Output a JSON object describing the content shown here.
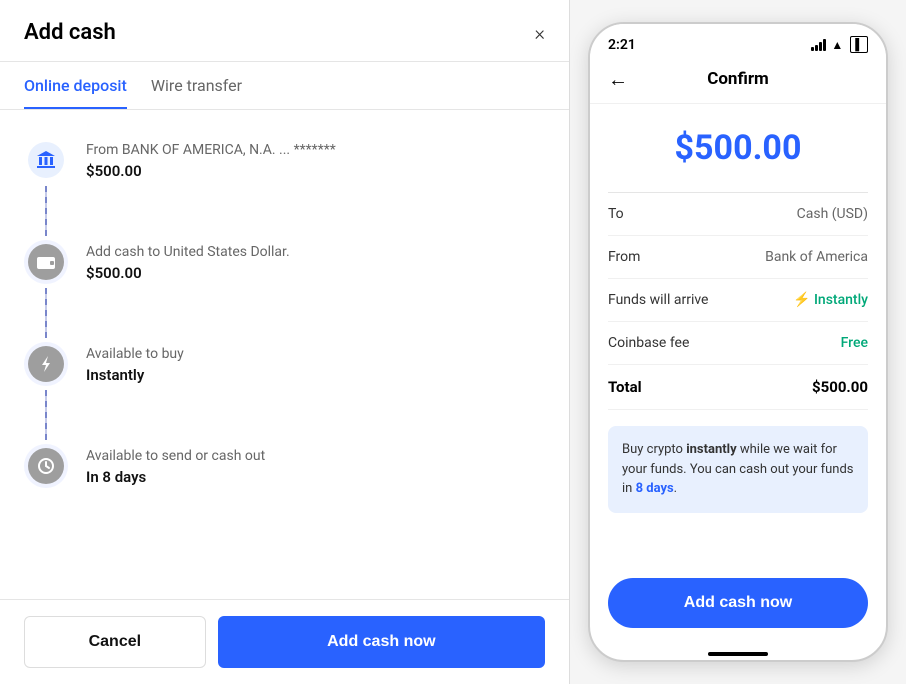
{
  "left": {
    "title": "Add cash",
    "close_label": "×",
    "tabs": [
      {
        "id": "online-deposit",
        "label": "Online deposit",
        "active": true
      },
      {
        "id": "wire-transfer",
        "label": "Wire transfer",
        "active": false
      }
    ],
    "steps": [
      {
        "icon_type": "bank",
        "label": "From BANK OF AMERICA, N.A. ... *******",
        "value": "$500.00"
      },
      {
        "icon_type": "wallet",
        "label": "Add cash to United States Dollar.",
        "value": "$500.00"
      },
      {
        "icon_type": "bolt",
        "label": "Available to buy",
        "value": "Instantly"
      },
      {
        "icon_type": "clock",
        "label": "Available to send or cash out",
        "value": "In 8 days"
      }
    ],
    "footer": {
      "cancel_label": "Cancel",
      "add_cash_label": "Add cash now"
    }
  },
  "right": {
    "status_bar": {
      "time": "2:21"
    },
    "header": {
      "back_icon": "←",
      "title": "Confirm"
    },
    "amount": "$500.00",
    "rows": [
      {
        "label": "To",
        "value": "Cash (USD)",
        "style": "normal"
      },
      {
        "label": "From",
        "value": "Bank of America",
        "style": "normal"
      },
      {
        "label": "Funds will arrive",
        "value": "Instantly",
        "style": "green"
      },
      {
        "label": "Coinbase fee",
        "value": "Free",
        "style": "free"
      },
      {
        "label": "Total",
        "value": "$500.00",
        "style": "bold"
      }
    ],
    "info_text_1": "Buy crypto ",
    "info_bold_1": "instantly",
    "info_text_2": " while we wait for your funds. You can cash out your funds in ",
    "info_bold_2": "8 days",
    "info_text_3": ".",
    "footer": {
      "add_cash_label": "Add cash now"
    }
  }
}
